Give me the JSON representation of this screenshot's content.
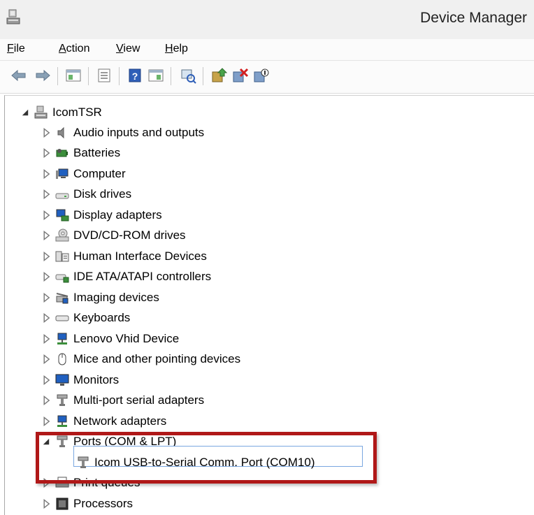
{
  "window": {
    "title": "Device Manager"
  },
  "menu": [
    {
      "label": "File",
      "key": "F",
      "rest": "ile"
    },
    {
      "label": "Action",
      "key": "A",
      "rest": "ction"
    },
    {
      "label": "View",
      "key": "V",
      "rest": "iew"
    },
    {
      "label": "Help",
      "key": "H",
      "rest": "elp"
    }
  ],
  "toolbar": {
    "buttons": [
      "back-icon",
      "forward-icon",
      "show-hide-console-tree-icon",
      "properties-icon",
      "help-icon",
      "action-pane-icon",
      "scan-hardware-changes-icon",
      "update-driver-icon",
      "uninstall-icon",
      "disable-icon"
    ]
  },
  "tree": {
    "root": "IcomTSR",
    "items": [
      "Audio inputs and outputs",
      "Batteries",
      "Computer",
      "Disk drives",
      "Display adapters",
      "DVD/CD-ROM drives",
      "Human Interface Devices",
      "IDE ATA/ATAPI controllers",
      "Imaging devices",
      "Keyboards",
      "Lenovo Vhid Device",
      "Mice and other pointing devices",
      "Monitors",
      "Multi-port serial adapters",
      "Network adapters",
      "Ports (COM & LPT)",
      "Print queues",
      "Processors"
    ],
    "ports_child": "Icom USB-to-Serial Comm. Port (COM10)"
  },
  "colors": {
    "highlight_border": "#b01818",
    "selection_border": "#7aa7e0"
  }
}
